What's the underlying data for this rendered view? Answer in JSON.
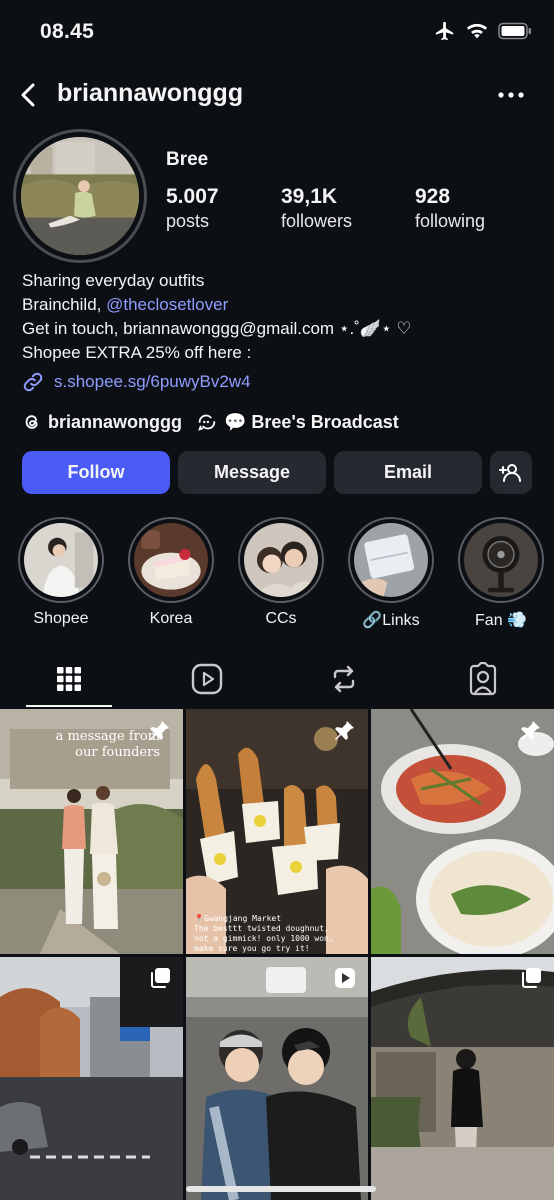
{
  "status_bar": {
    "time": "08.45",
    "icons": [
      "airplane-icon",
      "wifi-icon",
      "battery-icon"
    ]
  },
  "header": {
    "username": "briannawonggg"
  },
  "profile": {
    "name": "Bree",
    "stats": [
      {
        "value": "5.007",
        "label": "posts"
      },
      {
        "value": "39,1K",
        "label": "followers"
      },
      {
        "value": "928",
        "label": "following"
      }
    ],
    "bio": {
      "line1": "Sharing everyday outfits",
      "line2_prefix": "Brainchild, ",
      "line2_mention": "@theclosetlover",
      "line3": "Get in touch, briannawonggg@gmail.com ⋆.˚🪽⋆ ♡",
      "line4": "Shopee EXTRA 25% off here :"
    },
    "link": "s.shopee.sg/6puwyBv2w4",
    "threads_handle": "briannawonggg",
    "broadcast": "💬 Bree's Broadcast"
  },
  "actions": {
    "follow": "Follow",
    "message": "Message",
    "email": "Email"
  },
  "highlights": [
    {
      "label": "Shopee"
    },
    {
      "label": "Korea"
    },
    {
      "label": "CCs"
    },
    {
      "label": "🔗Links"
    },
    {
      "label": "Fan 💨"
    }
  ],
  "tabs": [
    "grid-icon",
    "reels-icon",
    "reposts-icon",
    "tagged-icon"
  ],
  "posts": [
    {
      "caption": "a message from\nour founders",
      "badge": "pin-icon"
    },
    {
      "caption": "📍Gwangjang Market\nThe besttt twisted doughnut,\nnot a gimmick! only 1000 won,\nmake sure you go try it!",
      "badge": "pin-icon"
    },
    {
      "caption": "",
      "badge": "pin-icon"
    },
    {
      "caption": "",
      "badge": "carousel-icon"
    },
    {
      "caption": "",
      "badge": "reel-icon"
    },
    {
      "caption": "",
      "badge": "carousel-icon"
    }
  ],
  "colors": {
    "background": "#0c1014",
    "accent": "#4a5cf5",
    "link": "#8f9cff",
    "button": "#262a30"
  }
}
